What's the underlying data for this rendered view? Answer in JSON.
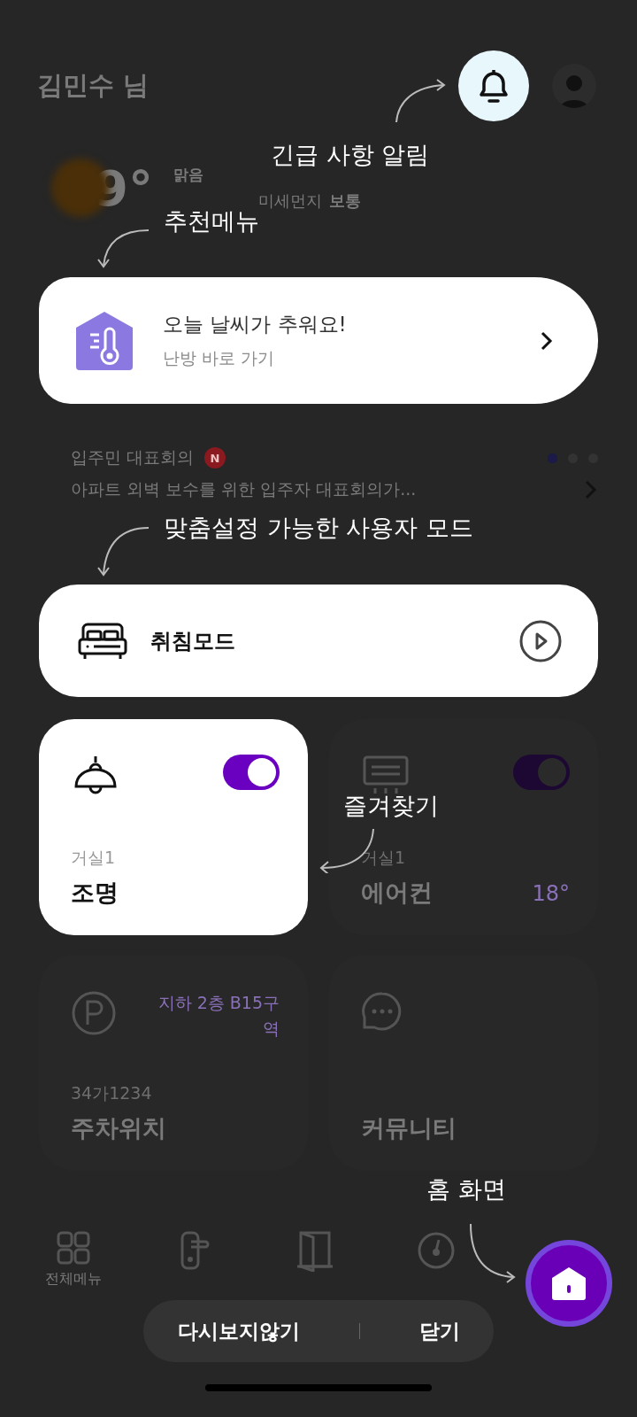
{
  "header": {
    "greeting": "김민수 님"
  },
  "weather": {
    "temperature": "9°",
    "condition": "맑음",
    "dust_label": "미세먼지",
    "dust_value": "보통"
  },
  "recommendation": {
    "title": "오늘 날씨가 추워요!",
    "subtitle": "난방 바로 가기"
  },
  "notice": {
    "title": "입주민 대표회의",
    "badge": "N",
    "text": "아파트 외벽 보수를 위한 입주자 대표회의가...",
    "pages": [
      {
        "selected": true
      },
      {
        "selected": false
      },
      {
        "selected": false
      }
    ]
  },
  "mode": {
    "label": "취침모드"
  },
  "devices": [
    {
      "kind": "lamp",
      "highlighted": true,
      "on": true,
      "room": "거실1",
      "name": "조명"
    },
    {
      "kind": "aircon",
      "highlighted": false,
      "on": true,
      "room": "거실1",
      "name": "에어컨",
      "value": "18°"
    },
    {
      "kind": "parking",
      "highlighted": false,
      "detail": "지하 2층 B15구역",
      "room": "34가1234",
      "name": "주차위치"
    },
    {
      "kind": "community",
      "highlighted": false,
      "name": "커뮤니티"
    }
  ],
  "bottom_nav": [
    {
      "kind": "grid",
      "label": "전체메뉴"
    },
    {
      "kind": "doorlock"
    },
    {
      "kind": "door"
    },
    {
      "kind": "gauge"
    }
  ],
  "coach_marks": [
    {
      "text": "긴급 사항 알림"
    },
    {
      "text": "추천메뉴"
    },
    {
      "text": "맞춤설정 가능한 사용자 모드"
    },
    {
      "text": "즐겨찾기"
    },
    {
      "text": "홈 화면"
    }
  ],
  "dialog_actions": [
    {
      "label": "다시보지않기"
    },
    {
      "label": "닫기"
    }
  ]
}
